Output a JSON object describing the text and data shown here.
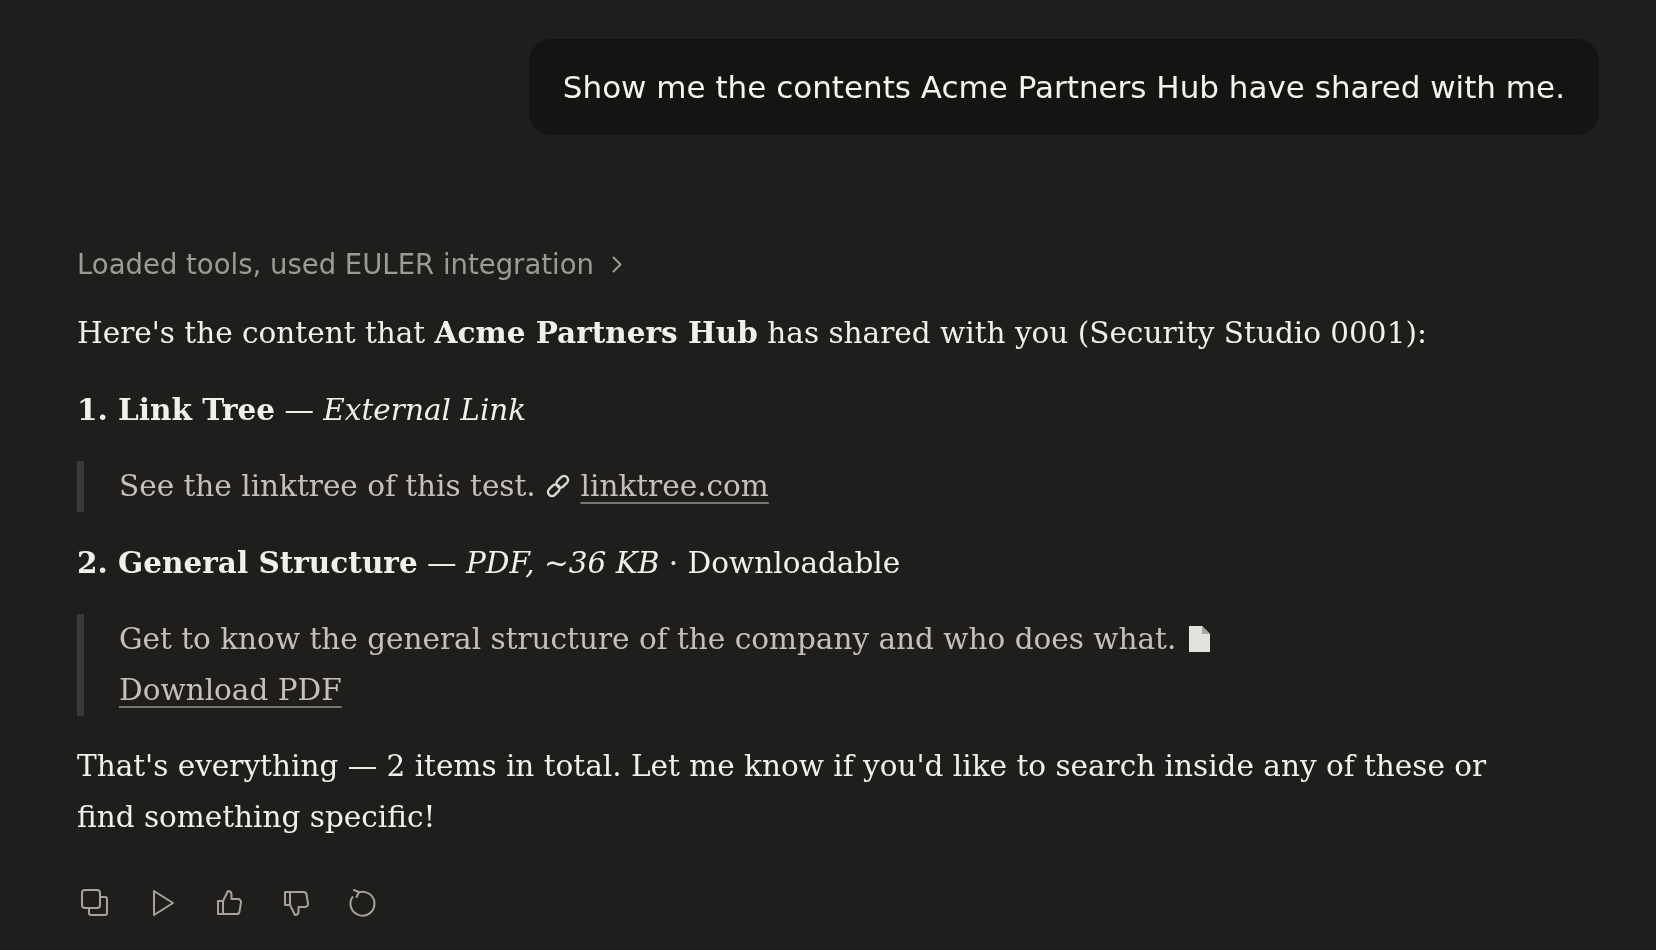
{
  "user_message": {
    "text": "Show me the contents Acme Partners Hub have shared with me."
  },
  "response": {
    "tool_summary": {
      "label": "Loaded tools, used EULER integration",
      "expanded": false
    },
    "intro": "Here's the content that **Acme Partners Hub** has shared with you (Security Studio 0001):",
    "items": [
      {
        "heading": "**1. Link Tree** — *External Link*",
        "description": "See the linktree of this test.",
        "attachment": {
          "kind": "link",
          "label": "linktree.com"
        }
      },
      {
        "heading": "**2. General Structure** — *PDF, ~36 KB* · Downloadable",
        "description": "Get to know the general structure of the company and who does what.",
        "attachment": {
          "kind": "file",
          "label": "Download PDF"
        }
      }
    ],
    "closing": "That's everything — 2 items in total. Let me know if you'd like to search inside any of these or find something specific!"
  }
}
